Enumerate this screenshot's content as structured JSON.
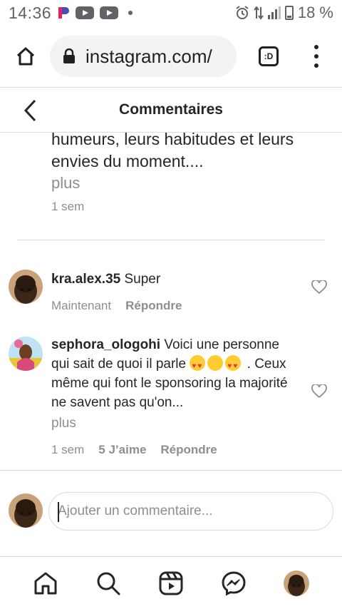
{
  "status_bar": {
    "time": "14:36",
    "battery": "18 %",
    "icons": [
      "pi-icon",
      "youtube-icon",
      "youtube-icon",
      "dot-icon",
      "alarm-icon",
      "network-icon",
      "signal-icon",
      "battery-icon"
    ]
  },
  "browser": {
    "url": "instagram.com/",
    "tabs_label": ":D"
  },
  "header": {
    "title": "Commentaires"
  },
  "caption": {
    "text": "humeurs, leurs habitudes et leurs envies du moment....",
    "more": "plus",
    "time": "1 sem"
  },
  "comments": [
    {
      "username": "kra.alex.35",
      "text": "Super",
      "time": "Maintenant",
      "reply": "Répondre"
    },
    {
      "username": "sephora_ologohi",
      "text_before": "Voici une personne qui sait de quoi il parle",
      "text_after": ". Ceux même qui font le sponsoring la majorité ne savent pas qu'on...",
      "more": "plus",
      "time": "1 sem",
      "likes": "5 J’aime",
      "reply": "Répondre"
    }
  ],
  "add_comment": {
    "placeholder": "Ajouter un commentaire..."
  },
  "colors": {
    "text": "#262626",
    "secondary": "#8e8e8e",
    "divider": "#dbdbdb",
    "status": "#5f6368"
  }
}
